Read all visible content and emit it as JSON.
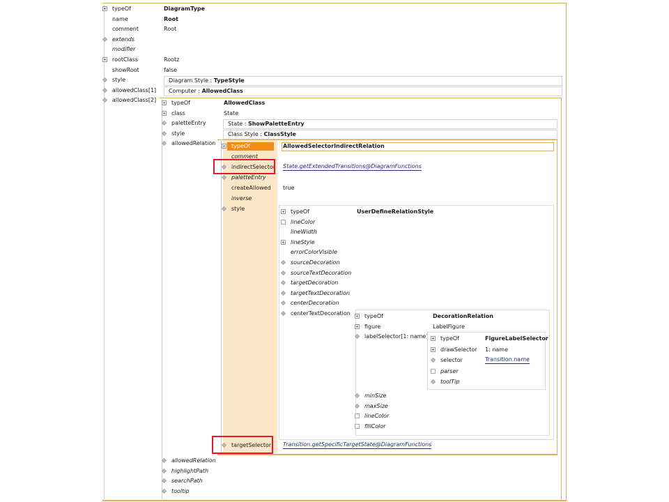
{
  "root": {
    "rows": [
      {
        "label": "typeOf",
        "value": "DiagramType",
        "icon": "plus-square-icon",
        "italic": false,
        "bold_value": true
      },
      {
        "label": "name",
        "value": "Root",
        "icon": "",
        "italic": false,
        "bold_value": true
      },
      {
        "label": "comment",
        "value": "Root",
        "icon": "",
        "italic": false,
        "bold_value": false
      },
      {
        "label": "extends",
        "value": "",
        "icon": "diamond-icon",
        "italic": true,
        "bold_value": false
      },
      {
        "label": "modifier",
        "value": "",
        "icon": "",
        "italic": true,
        "bold_value": false
      },
      {
        "label": "rootClass",
        "value": "Rootz",
        "icon": "plus-square-icon",
        "italic": false,
        "bold_value": false
      },
      {
        "label": "showRoot",
        "value": "false",
        "icon": "",
        "italic": false,
        "bold_value": false
      },
      {
        "label": "style",
        "value": "",
        "icon": "diamond-icon",
        "italic": false,
        "bold_value": false
      },
      {
        "label": "allowedClass[1]",
        "value": "",
        "icon": "diamond-icon",
        "italic": false,
        "bold_value": false
      },
      {
        "label": "allowedClass[2]",
        "value": "",
        "icon": "diamond-icon",
        "italic": false,
        "bold_value": false
      }
    ],
    "style_field": {
      "prefix": "Diagram Style : ",
      "value": "TypeStyle"
    },
    "allowed_class_1_field": {
      "prefix": "Computer : ",
      "value": "AllowedClass"
    }
  },
  "allowed_class_2": {
    "rows": [
      {
        "label": "typeOf",
        "value": "AllowedClass",
        "icon": "plus-square-icon",
        "italic": false,
        "bold_value": true
      },
      {
        "label": "class",
        "value": "State",
        "icon": "plus-square-icon",
        "italic": false,
        "bold_value": false
      },
      {
        "label": "paletteEntry",
        "value": "",
        "icon": "diamond-icon",
        "italic": false,
        "bold_value": false
      },
      {
        "label": "style",
        "value": "",
        "icon": "diamond-icon",
        "italic": false,
        "bold_value": false
      },
      {
        "label": "allowedRelation",
        "value": "",
        "icon": "diamond-icon",
        "italic": false,
        "bold_value": false
      }
    ],
    "palette_field": {
      "prefix": "State : ",
      "value": "ShowPaletteEntry"
    },
    "style_field": {
      "prefix": "Class Style : ",
      "value": "ClassStyle"
    },
    "tail_rows": [
      {
        "label": "allowedRelation",
        "icon": "diamond-icon"
      },
      {
        "label": "highlightPath",
        "icon": "diamond-icon"
      },
      {
        "label": "searchPath",
        "icon": "diamond-icon"
      },
      {
        "label": "tooltip",
        "icon": "diamond-icon"
      }
    ]
  },
  "allowed_relation": {
    "rows": [
      {
        "label": "typeOf",
        "value": "AllowedSelectorIndirectRelation",
        "icon": "plus-square-icon",
        "italic": false,
        "bold_value": true,
        "selected": true
      },
      {
        "label": "comment",
        "value": "",
        "icon": "",
        "italic": true,
        "bold_value": false
      },
      {
        "label": "indirectSelector",
        "value": "State.getExtendedTransitions@DiagramFunctions",
        "icon": "diamond-icon",
        "italic": false,
        "bold_value": false,
        "link": true
      },
      {
        "label": "paletteEntry",
        "value": "",
        "icon": "diamond-icon",
        "italic": true,
        "bold_value": false
      },
      {
        "label": "createAllowed",
        "value": "true",
        "icon": "",
        "italic": false,
        "bold_value": false
      },
      {
        "label": "inverse",
        "value": "",
        "icon": "",
        "italic": true,
        "bold_value": false
      },
      {
        "label": "style",
        "value": "",
        "icon": "diamond-icon",
        "italic": false,
        "bold_value": false
      }
    ],
    "target_selector": {
      "label": "targetSelector",
      "value": "Transition.getSpecificTargetState@DiagramFunctions",
      "icon": "diamond-icon"
    }
  },
  "relation_style": {
    "rows": [
      {
        "label": "typeOf",
        "value": "UserDefineRelationStyle",
        "icon": "plus-square-icon",
        "italic": false,
        "bold_value": true
      },
      {
        "label": "lineColor",
        "icon": "square-icon",
        "italic": true
      },
      {
        "label": "lineWidth",
        "icon": "",
        "italic": true
      },
      {
        "label": "lineStyle",
        "icon": "plus-square-icon",
        "italic": true
      },
      {
        "label": "errorColorVisible",
        "icon": "",
        "italic": true
      },
      {
        "label": "sourceDecoration",
        "icon": "diamond-icon",
        "italic": true
      },
      {
        "label": "sourceTextDecoration",
        "icon": "diamond-icon",
        "italic": true
      },
      {
        "label": "targetDecoration",
        "icon": "diamond-icon",
        "italic": true
      },
      {
        "label": "targetTextDecoration",
        "icon": "diamond-icon",
        "italic": true
      },
      {
        "label": "centerDecoration",
        "icon": "diamond-icon",
        "italic": true
      },
      {
        "label": "centerTextDecoration",
        "icon": "diamond-icon",
        "italic": false
      }
    ]
  },
  "decoration_relation": {
    "rows": [
      {
        "label": "typeOf",
        "value": "DecorationRelation",
        "icon": "plus-square-icon",
        "italic": false,
        "bold_value": true
      },
      {
        "label": "figure",
        "value": "LabelFigure",
        "icon": "plus-square-icon",
        "italic": false,
        "bold_value": false
      },
      {
        "label": "labelSelector[1: name]",
        "value": "",
        "icon": "diamond-icon",
        "italic": false,
        "bold_value": false
      }
    ],
    "tail_rows": [
      {
        "label": "minSize",
        "icon": "diamond-icon"
      },
      {
        "label": "maxSize",
        "icon": "diamond-icon"
      },
      {
        "label": "lineColor",
        "icon": "square-icon"
      },
      {
        "label": "fillColor",
        "icon": "square-icon"
      }
    ]
  },
  "figure_label_selector": {
    "rows": [
      {
        "label": "typeOf",
        "value": "FigureLabelSelector",
        "icon": "plus-square-icon",
        "italic": false,
        "bold_value": true
      },
      {
        "label": "drawSelector",
        "value": "1: name",
        "icon": "plus-square-icon",
        "italic": false,
        "bold_value": false
      },
      {
        "label": "selector",
        "value": "Transition.name",
        "icon": "diamond-icon",
        "italic": false,
        "bold_value": false,
        "underline": true
      },
      {
        "label": "parser",
        "value": "",
        "icon": "square-icon",
        "italic": true,
        "bold_value": false
      },
      {
        "label": "toolTip",
        "value": "",
        "icon": "diamond-icon",
        "italic": true,
        "bold_value": false
      }
    ]
  },
  "colors": {
    "panel_border": "#d9ad62",
    "label_column_bg": "#fbe7c8",
    "selected_bg": "#f28c13",
    "highlight_red": "#e8162e",
    "link_blue": "#1f2f6e"
  }
}
